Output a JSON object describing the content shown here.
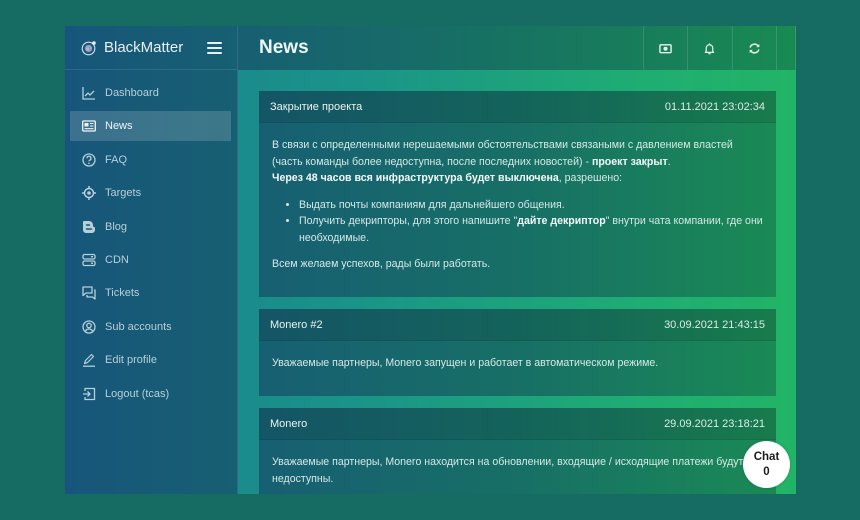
{
  "brand": {
    "name": "BlackMatter",
    "logo_icon": "orbit-logo-icon",
    "menu_icon": "hamburger-icon"
  },
  "header": {
    "title": "News",
    "actions": [
      {
        "icon": "money-icon",
        "label": "Balance"
      },
      {
        "icon": "bell-icon",
        "label": "Notifications"
      },
      {
        "icon": "refresh-icon",
        "label": "Refresh"
      }
    ]
  },
  "sidebar": {
    "items": [
      {
        "label": "Dashboard",
        "icon": "chart-line-icon",
        "active": false
      },
      {
        "label": "News",
        "icon": "newspaper-icon",
        "active": true
      },
      {
        "label": "FAQ",
        "icon": "question-circle-icon",
        "active": false
      },
      {
        "label": "Targets",
        "icon": "crosshair-icon",
        "active": false
      },
      {
        "label": "Blog",
        "icon": "blogger-icon",
        "active": false
      },
      {
        "label": "CDN",
        "icon": "server-icon",
        "active": false
      },
      {
        "label": "Tickets",
        "icon": "chat-bubbles-icon",
        "active": false
      },
      {
        "label": "Sub accounts",
        "icon": "user-circle-icon",
        "active": false
      },
      {
        "label": "Edit profile",
        "icon": "pencil-icon",
        "active": false
      },
      {
        "label": "Logout (tcas)",
        "icon": "logout-icon",
        "active": false
      }
    ]
  },
  "news": [
    {
      "title": "Закрытие проекта",
      "date": "01.11.2021 23:02:34",
      "p1_a": "В связи с определенными нерешаемыми обстоятельствами связаными с давлением властей (часть команды более недоступна, после последних новостей) - ",
      "p1_b": "проект закрыт",
      "p1_c": ".",
      "p2_a": "Через 48 часов вся инфраструктура будет выключена",
      "p2_b": ", разрешено:",
      "li1": "Выдать почты компаниям для дальнейшего общения.",
      "li2_a": "Получить декрипторы, для этого напишите \"",
      "li2_b": "дайте декриптор",
      "li2_c": "\" внутри чата компании, где они необходимые.",
      "p3": "Всем желаем успехов, рады были работать."
    },
    {
      "title": "Monero #2",
      "date": "30.09.2021 21:43:15",
      "body": "Уважаемые партнеры, Monero запущен и работает в автоматическом режиме."
    },
    {
      "title": "Monero",
      "date": "29.09.2021 23:18:21",
      "body": "Уважаемые партнеры, Monero находится на обновлении, входящие / исходящие платежи будут недоступны."
    }
  ],
  "chat": {
    "label": "Chat",
    "count": "0"
  }
}
